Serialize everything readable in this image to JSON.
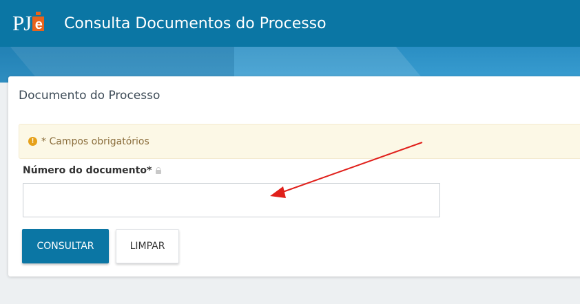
{
  "header": {
    "logo_text": "PJe",
    "title": "Consulta Documentos do Processo"
  },
  "card": {
    "title": "Documento do Processo",
    "alert_text": "* Campos obrigatórios",
    "field_label": "Número do documento*",
    "field_value": "",
    "consultar_label": "CONSULTAR",
    "limpar_label": "LIMPAR"
  },
  "colors": {
    "header": "#0b76a4",
    "banner": "#3a9ed2",
    "alert_bg": "#fcf8e6",
    "warning_icon": "#e6a11a",
    "annotation_arrow": "#e0201b"
  },
  "icons": {
    "alert": "exclamation-circle-icon",
    "field": "lock-icon"
  }
}
